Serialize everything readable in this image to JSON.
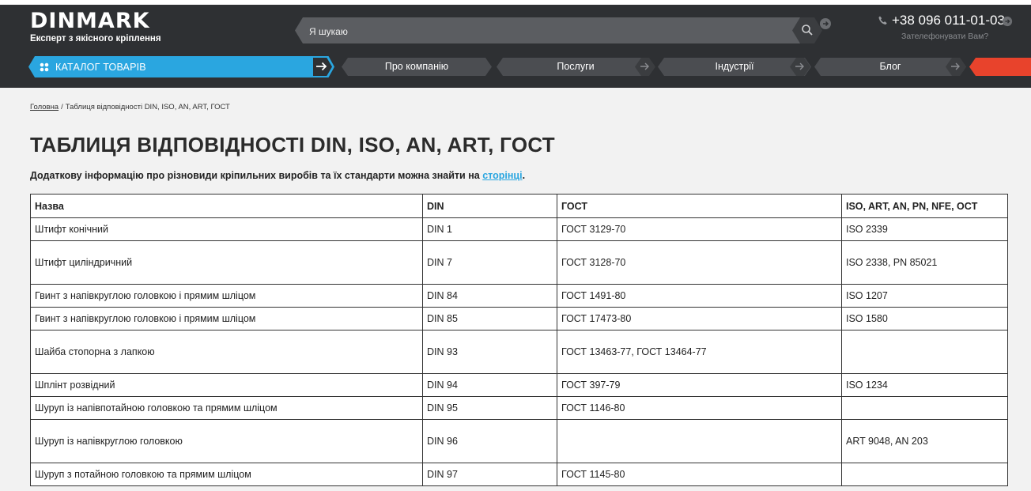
{
  "header": {
    "logo_word": "DINMARK",
    "logo_tagline": "Експерт з якісного кріплення",
    "search_placeholder": "Я шукаю",
    "phone": "+38 096 011-01-03",
    "callback": "Зателефонувати Вам?"
  },
  "nav": {
    "catalog_label": "КАТАЛОГ ТОВАРІВ",
    "items": [
      {
        "label": "Про компанію"
      },
      {
        "label": "Послуги"
      },
      {
        "label": "Індустрії"
      },
      {
        "label": "Блог"
      }
    ]
  },
  "breadcrumb": {
    "home": "Головна",
    "separator": "/",
    "current": "Таблиця відповідності DIN, ISO, AN, ART, ГОСТ"
  },
  "page": {
    "title": "ТАБЛИЦЯ ВІДПОВІДНОСТІ DIN, ISO, AN, ART, ГОСТ",
    "intro_text": "Додаткову інформацію про різновиди кріпильних виробів та їх стандарти можна знайти на ",
    "intro_link": "сторінці",
    "intro_end": "."
  },
  "table": {
    "headers": [
      "Назва",
      "DIN",
      "ГОСТ",
      "ISO, ART, AN, PN, NFE, OCT"
    ],
    "rows": [
      [
        "Штифт конічний",
        "DIN 1",
        "ГОСТ 3129-70",
        "ISO 2339"
      ],
      [
        "Штифт циліндричний",
        "DIN 7",
        "ГОСТ 3128-70",
        "ISO 2338, PN 85021"
      ],
      [
        "Гвинт з напівкруглою головкою і прямим шліцом",
        "DIN 84",
        "ГОСТ 1491-80",
        "ISO 1207"
      ],
      [
        "Гвинт з напівкруглою головкою і прямим шліцом",
        "DIN 85",
        "ГОСТ 17473-80",
        "ISO 1580"
      ],
      [
        "Шайба стопорна з лапкою",
        "DIN 93",
        "ГОСТ 13463-77, ГОСТ 13464-77",
        ""
      ],
      [
        "Шплінт розвідний",
        "DIN 94",
        "ГОСТ 397-79",
        "ISO 1234"
      ],
      [
        "Шуруп із напівпотайною головкою та прямим шліцом",
        "DIN 95",
        "ГОСТ 1146-80",
        ""
      ],
      [
        "Шуруп із напівкруглою головкою",
        "DIN 96",
        "",
        "ART 9048, AN 203"
      ],
      [
        "Шуруп з потайною головкою та прямим шліцом",
        "DIN 97",
        "ГОСТ 1145-80",
        ""
      ]
    ]
  },
  "colors": {
    "header_bg": "#2e3033",
    "accent_blue": "#2aa6e0",
    "accent_red": "#e8432c"
  }
}
